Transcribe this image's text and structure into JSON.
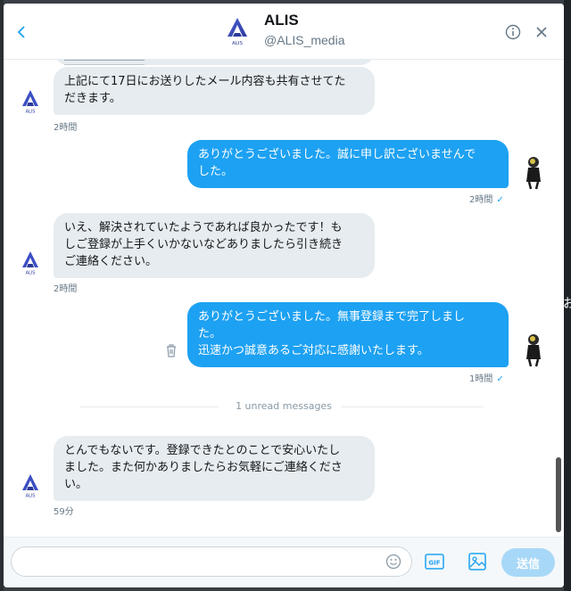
{
  "header": {
    "name": "ALIS",
    "handle": "@ALIS_media"
  },
  "avatar": {
    "logo_text": "ALIS"
  },
  "messages": [
    {
      "dir": "in",
      "text": "上記にて17日にお送りしたメール内容も共有させてた\nだきます。",
      "time": "2時間"
    },
    {
      "dir": "out",
      "text": "ありがとうございました。誠に申し訳ございませんで\nした。",
      "time": "2時間",
      "check": "✓"
    },
    {
      "dir": "in",
      "text": "いえ、解決されていたようであれば良かったです！も\nしご登録が上手くいかないなどありましたら引き続き\nご連絡ください。",
      "time": "2時間"
    },
    {
      "dir": "out",
      "text": "ありがとうございました。無事登録まで完了しまし\nた。\n迅速かつ誠意あるご対応に感謝いたします。",
      "time": "1時間",
      "check": "✓"
    },
    {
      "dir": "in",
      "text": "とんでもないです。登録できたとのことで安心いたし\nました。また何かありましたらお気軽にご連絡くださ\nい。",
      "time": "59分"
    }
  ],
  "divider": {
    "text": "1 unread messages"
  },
  "composer": {
    "placeholder": "",
    "gif_label": "GIF",
    "send_label": "送信"
  },
  "background": {
    "right_char": "お"
  },
  "colors": {
    "accent": "#1da1f2",
    "bubble_in": "#e6ecf0",
    "send_disabled": "#a8d8f7"
  }
}
